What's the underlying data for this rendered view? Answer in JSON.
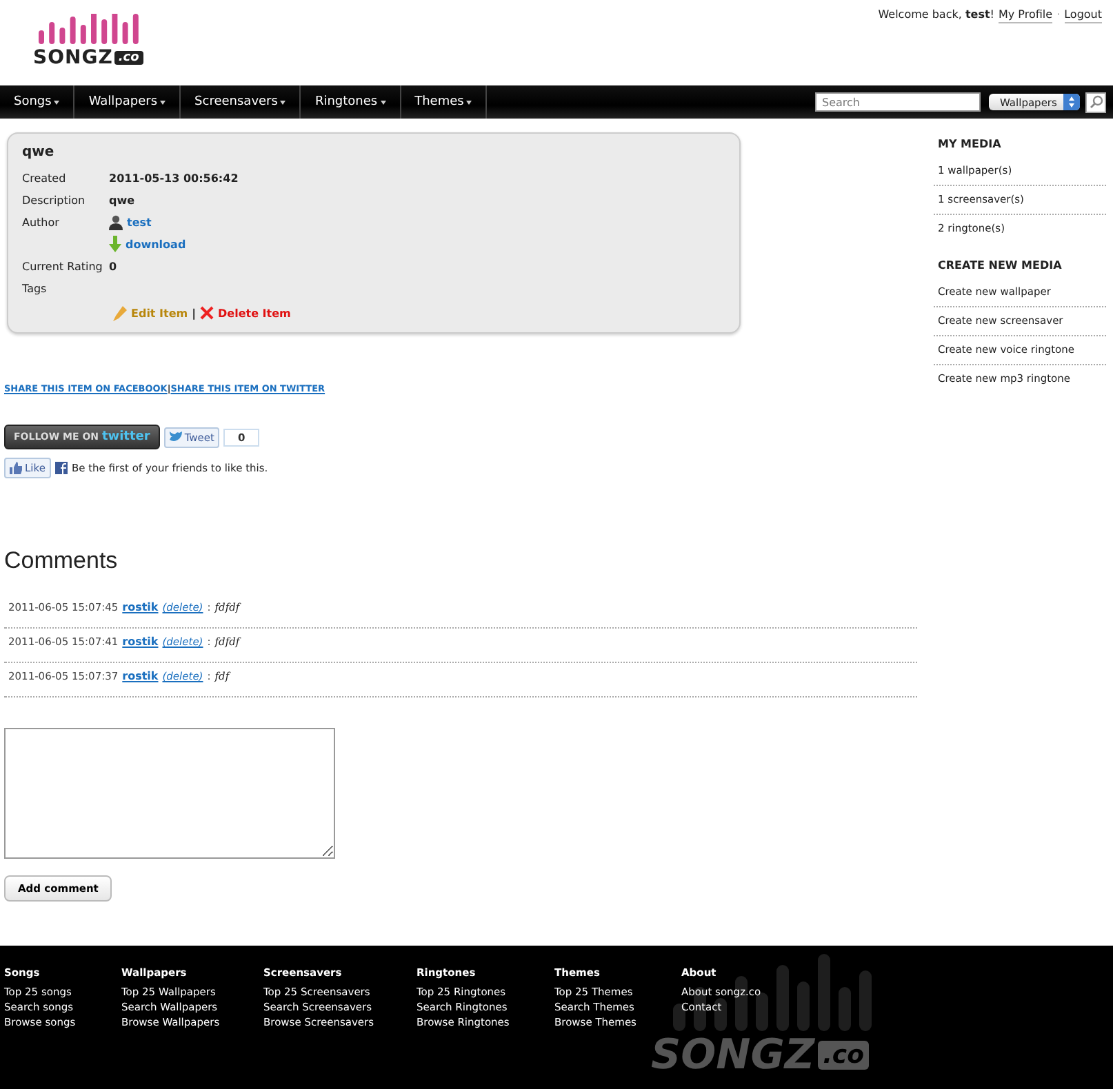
{
  "logo": {
    "name": "SONGZ",
    "suffix": ".co"
  },
  "user_bar": {
    "greeting": "Welcome back,",
    "user": "test",
    "exclaim": "!",
    "links": [
      "My Profile",
      "Logout"
    ],
    "separator": "·"
  },
  "nav": {
    "items": [
      {
        "label": "Songs"
      },
      {
        "label": "Wallpapers"
      },
      {
        "label": "Screensavers"
      },
      {
        "label": "Ringtones"
      },
      {
        "label": "Themes"
      }
    ],
    "search": {
      "placeholder": "Search"
    },
    "category": "Wallpapers"
  },
  "item": {
    "title": "qwe",
    "fields": [
      {
        "kind": "text",
        "label": "Created",
        "value": "2011-05-13 00:56:42"
      },
      {
        "kind": "text",
        "label": "Description",
        "value": "qwe"
      },
      {
        "kind": "user",
        "label": "Author",
        "value": "test"
      },
      {
        "kind": "download",
        "value": "download"
      },
      {
        "kind": "text",
        "label": "Current Rating",
        "value": "0"
      },
      {
        "kind": "text",
        "label": "Tags"
      }
    ],
    "actions": {
      "edit": "Edit Item",
      "separator": "|",
      "delete": "Delete Item"
    }
  },
  "share": {
    "facebook": "SHARE THIS ITEM ON FACEBOOK",
    "separator": "|",
    "twitter": "SHARE THIS ITEM ON TWITTER"
  },
  "social": {
    "follow_label": "FOLLOW ME ON",
    "follow_brand": "twitter",
    "tweet": "Tweet",
    "tweet_count": "0",
    "like": "Like",
    "like_text": "Be the first of your friends to like this."
  },
  "comments": {
    "heading": "Comments",
    "items": [
      {
        "date": "2011-06-05 15:07:45",
        "author": "rostik",
        "delete": "(delete)",
        "separator": ":",
        "text": "fdfdf"
      },
      {
        "date": "2011-06-05 15:07:41",
        "author": "rostik",
        "delete": "(delete)",
        "separator": ":",
        "text": "fdfdf"
      },
      {
        "date": "2011-06-05 15:07:37",
        "author": "rostik",
        "delete": "(delete)",
        "separator": ":",
        "text": "fdf"
      }
    ],
    "submit": "Add comment"
  },
  "sidebar": {
    "sections": [
      {
        "heading": "MY MEDIA",
        "links": [
          "1 wallpaper(s)",
          "1 screensaver(s)",
          "2 ringtone(s)"
        ]
      },
      {
        "heading": "CREATE NEW MEDIA",
        "links": [
          "Create new wallpaper",
          "Create new screensaver",
          "Create new voice ringtone",
          "Create new mp3 ringtone"
        ]
      }
    ]
  },
  "footer": {
    "columns": [
      {
        "heading": "Songs",
        "links": [
          "Top 25 songs",
          "Search songs",
          "Browse songs"
        ]
      },
      {
        "heading": "Wallpapers",
        "links": [
          "Top 25 Wallpapers",
          "Search Wallpapers",
          "Browse Wallpapers"
        ]
      },
      {
        "heading": "Screensavers",
        "links": [
          "Top 25 Screensavers",
          "Search Screensavers",
          "Browse Screensavers"
        ]
      },
      {
        "heading": "Ringtones",
        "links": [
          "Top 25 Ringtones",
          "Search Ringtones",
          "Browse Ringtones"
        ]
      },
      {
        "heading": "Themes",
        "links": [
          "Top 25 Themes",
          "Search Themes",
          "Browse Themes"
        ]
      },
      {
        "heading": "About",
        "links": [
          "About songz.co",
          "Contact"
        ]
      }
    ],
    "watermark": {
      "name": "SONGZ",
      "suffix": ".co"
    }
  }
}
